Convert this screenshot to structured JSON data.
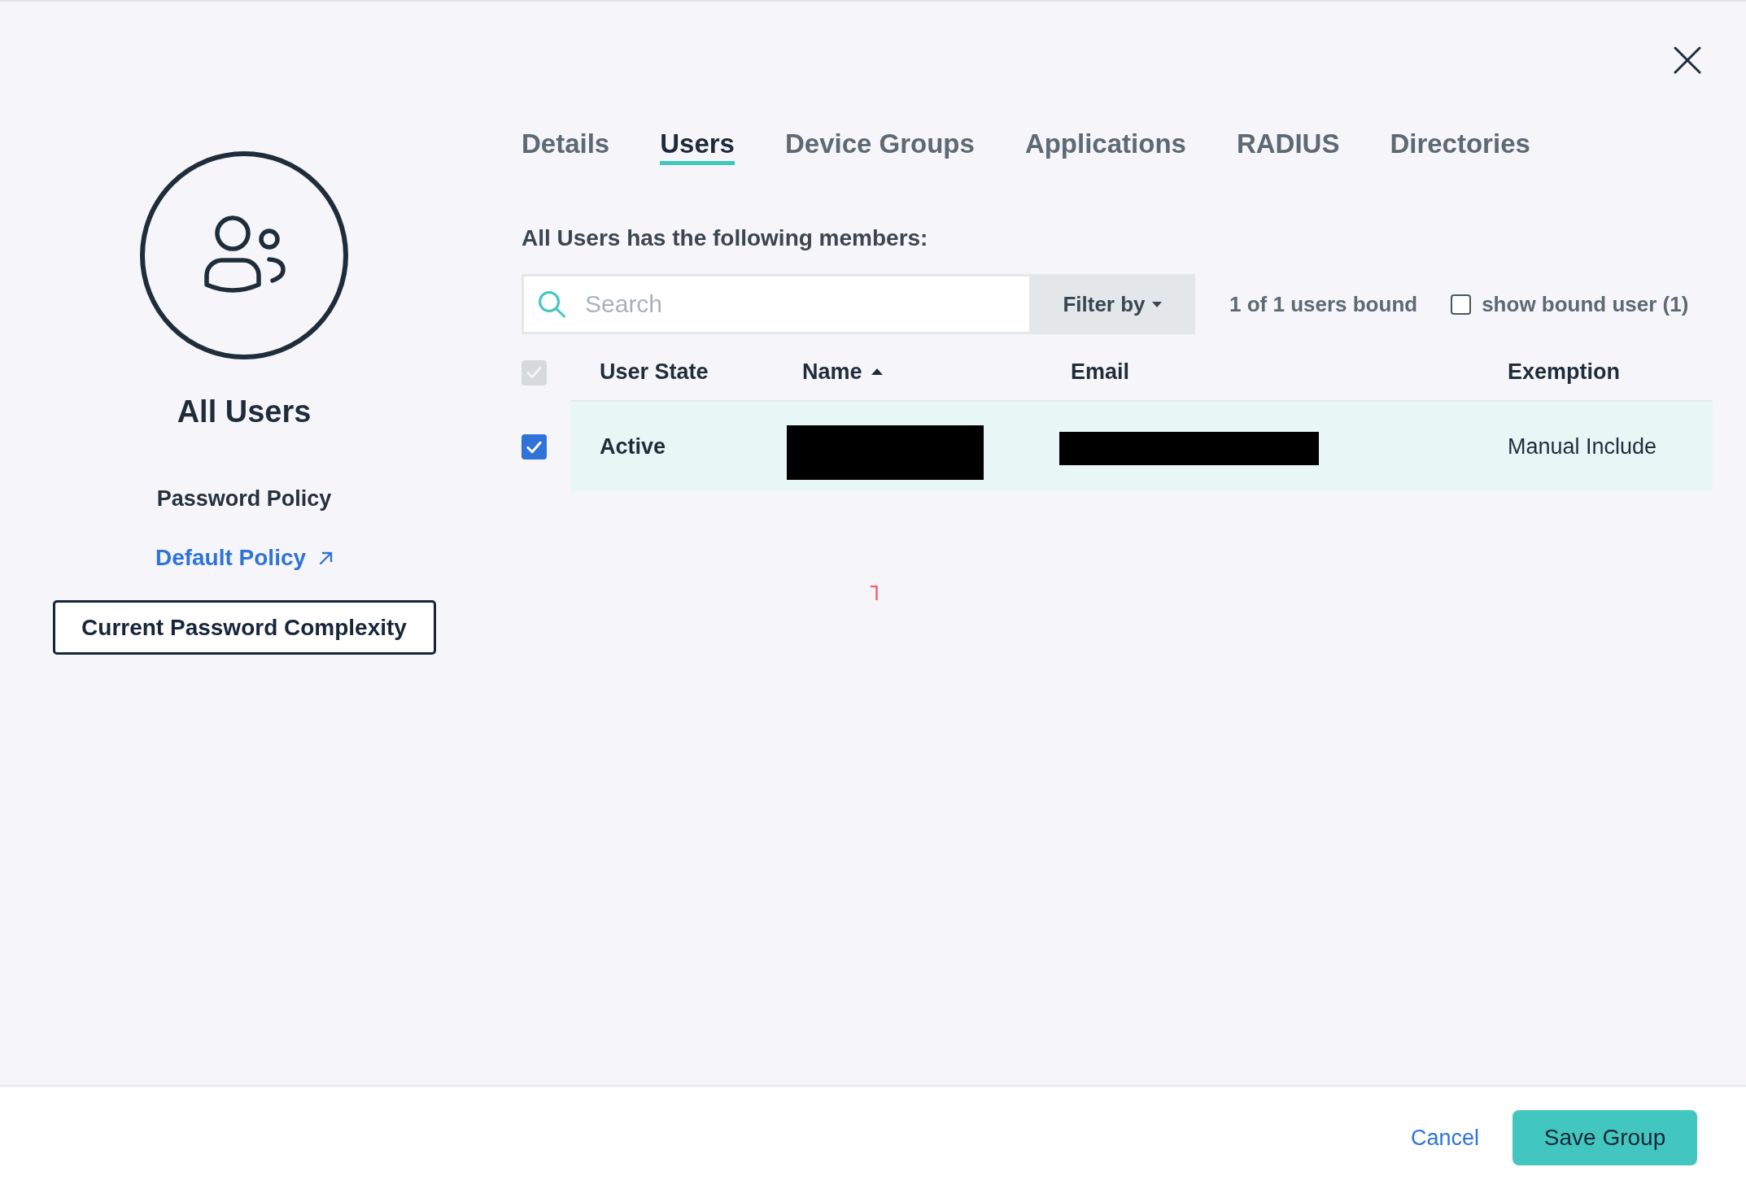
{
  "group": {
    "name": "All Users"
  },
  "password_policy": {
    "heading": "Password Policy",
    "link": "Default Policy",
    "complexity_button": "Current Password Complexity"
  },
  "tabs": [
    {
      "label": "Details",
      "selected": false
    },
    {
      "label": "Users",
      "selected": true
    },
    {
      "label": "Device Groups",
      "selected": false
    },
    {
      "label": "Applications",
      "selected": false
    },
    {
      "label": "RADIUS",
      "selected": false
    },
    {
      "label": "Directories",
      "selected": false
    }
  ],
  "members_heading": "All Users has the following members:",
  "toolbar": {
    "search": {
      "placeholder": "Search"
    },
    "filter": {
      "label": "Filter by"
    },
    "bound_count": "1 of 1 users bound",
    "show_bound": {
      "label": "show bound user (1)",
      "checked": false
    }
  },
  "table": {
    "select_all": {
      "checked": true,
      "disabled": true
    },
    "columns": [
      {
        "label": "User State",
        "sorted": false
      },
      {
        "label": "Name",
        "sorted": true
      },
      {
        "label": "Email",
        "sorted": false
      },
      {
        "label": "Exemption",
        "sorted": false
      }
    ],
    "rows": [
      {
        "checked": true,
        "user_state": "Active",
        "name_redacted": true,
        "email_redacted": true,
        "exemption": "Manual Include"
      }
    ]
  },
  "footer": {
    "cancel": "Cancel",
    "save": "Save Group"
  }
}
